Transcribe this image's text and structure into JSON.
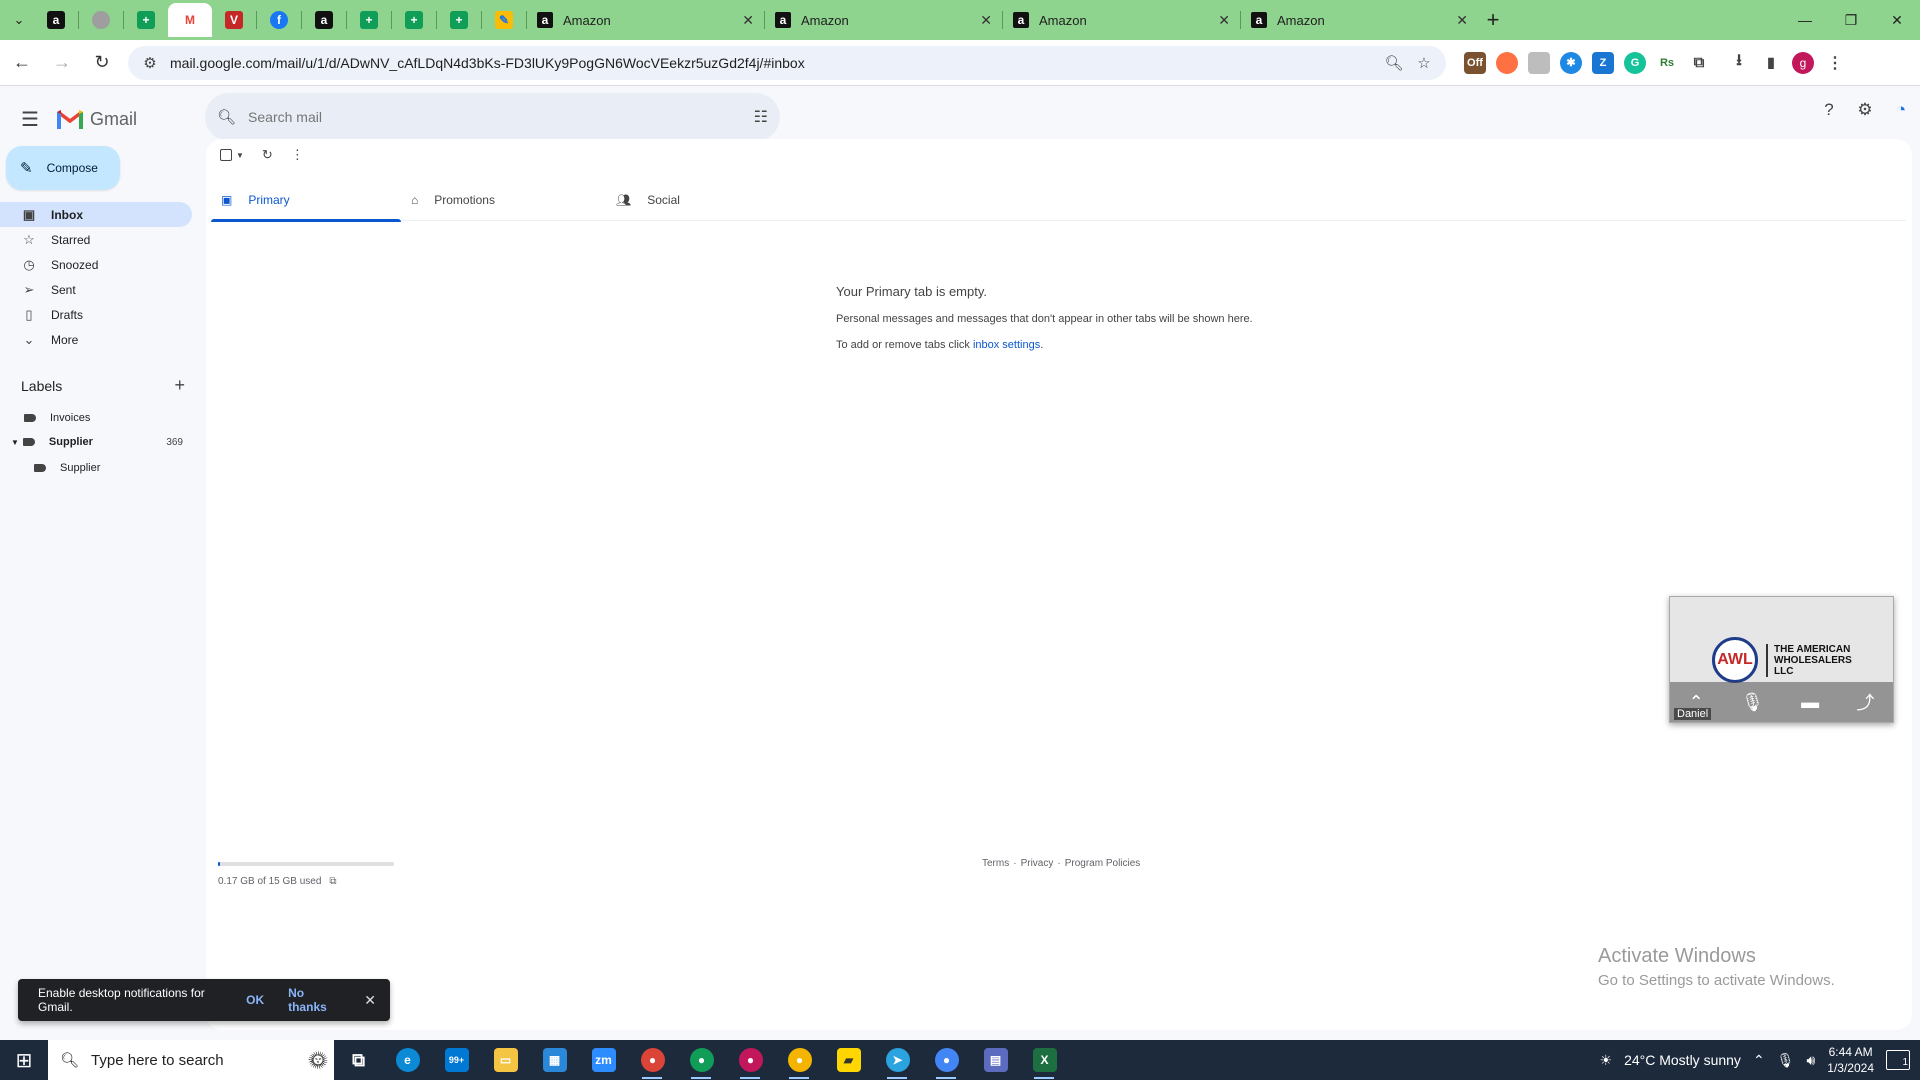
{
  "browser": {
    "tabs": [
      {
        "title": "Amazon"
      },
      {
        "title": "Amazon"
      },
      {
        "title": "Amazon"
      },
      {
        "title": "Amazon"
      }
    ],
    "url": "mail.google.com/mail/u/1/d/ADwNV_cAfLDqN4d3bKs-FD3lUKy9PogGN6WocVEekzr5uzGd2f4j/#inbox",
    "profile_initial": "g"
  },
  "gmail": {
    "app_name": "Gmail",
    "search_placeholder": "Search mail",
    "compose_label": "Compose",
    "nav": [
      {
        "label": "Inbox",
        "icon": "inbox-icon"
      },
      {
        "label": "Starred",
        "icon": "star-icon"
      },
      {
        "label": "Snoozed",
        "icon": "clock-icon"
      },
      {
        "label": "Sent",
        "icon": "send-icon"
      },
      {
        "label": "Drafts",
        "icon": "draft-icon"
      },
      {
        "label": "More",
        "icon": "chevron-down-icon"
      }
    ],
    "labels_title": "Labels",
    "labels": [
      {
        "name": "Invoices",
        "count": ""
      },
      {
        "name": "Supplier",
        "count": "369"
      },
      {
        "name": "Supplier",
        "count": ""
      }
    ],
    "category_tabs": [
      {
        "label": "Primary"
      },
      {
        "label": "Promotions"
      },
      {
        "label": "Social"
      }
    ],
    "empty_state": {
      "heading": "Your Primary tab is empty.",
      "line1": "Personal messages and messages that don't appear in other tabs will be shown here.",
      "line2_prefix": "To add or remove tabs click ",
      "line2_link": "inbox settings",
      "line2_suffix": "."
    },
    "storage": {
      "text": "0.17 GB of 15 GB used",
      "fraction": 0.011
    },
    "footer": {
      "terms": "Terms",
      "privacy": "Privacy",
      "policies": "Program Policies",
      "sep": "·"
    },
    "snackbar": {
      "message": "Enable desktop notifications for Gmail.",
      "ok": "OK",
      "no_thanks": "No thanks"
    }
  },
  "video_widget": {
    "logo_text": "AWL",
    "company": "THE AMERICAN WHOLESALERS LLC",
    "participant": "Daniel"
  },
  "watermark": {
    "line1": "Activate Windows",
    "line2": "Go to Settings to activate Windows."
  },
  "taskbar": {
    "search_placeholder": "Type here to search",
    "weather": "24°C  Mostly sunny",
    "time": "6:44 AM",
    "date": "1/3/2024",
    "mail_badge": "99+",
    "notification_count": "1"
  },
  "colors": {
    "tab_strip": "#8fd48e",
    "compose_bg": "#c2e7ff",
    "active_nav": "#d3e3fd",
    "accent": "#0b57d0"
  }
}
